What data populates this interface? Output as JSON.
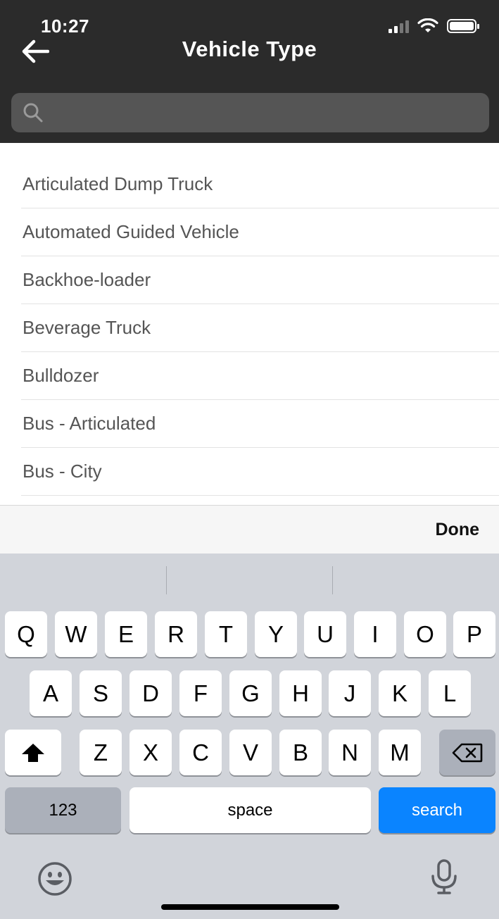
{
  "status": {
    "time": "10:27"
  },
  "header": {
    "title": "Vehicle Type"
  },
  "search": {
    "placeholder": "",
    "value": ""
  },
  "list": {
    "items": [
      "Articulated Dump Truck",
      "Automated Guided Vehicle",
      "Backhoe-loader",
      "Beverage Truck",
      "Bulldozer",
      "Bus - Articulated",
      "Bus - City"
    ]
  },
  "accessory": {
    "done_label": "Done"
  },
  "keyboard": {
    "row1": [
      "Q",
      "W",
      "E",
      "R",
      "T",
      "Y",
      "U",
      "I",
      "O",
      "P"
    ],
    "row2": [
      "A",
      "S",
      "D",
      "F",
      "G",
      "H",
      "J",
      "K",
      "L"
    ],
    "row3": [
      "Z",
      "X",
      "C",
      "V",
      "B",
      "N",
      "M"
    ],
    "numbers_label": "123",
    "space_label": "space",
    "search_label": "search"
  },
  "colors": {
    "header_bg": "#2b2b2b",
    "accent": "#0a84ff"
  },
  "icons": {
    "back": "arrow-left-icon",
    "search": "search-icon",
    "shift": "shift-icon",
    "delete": "backspace-icon",
    "emoji": "emoji-icon",
    "mic": "microphone-icon"
  }
}
